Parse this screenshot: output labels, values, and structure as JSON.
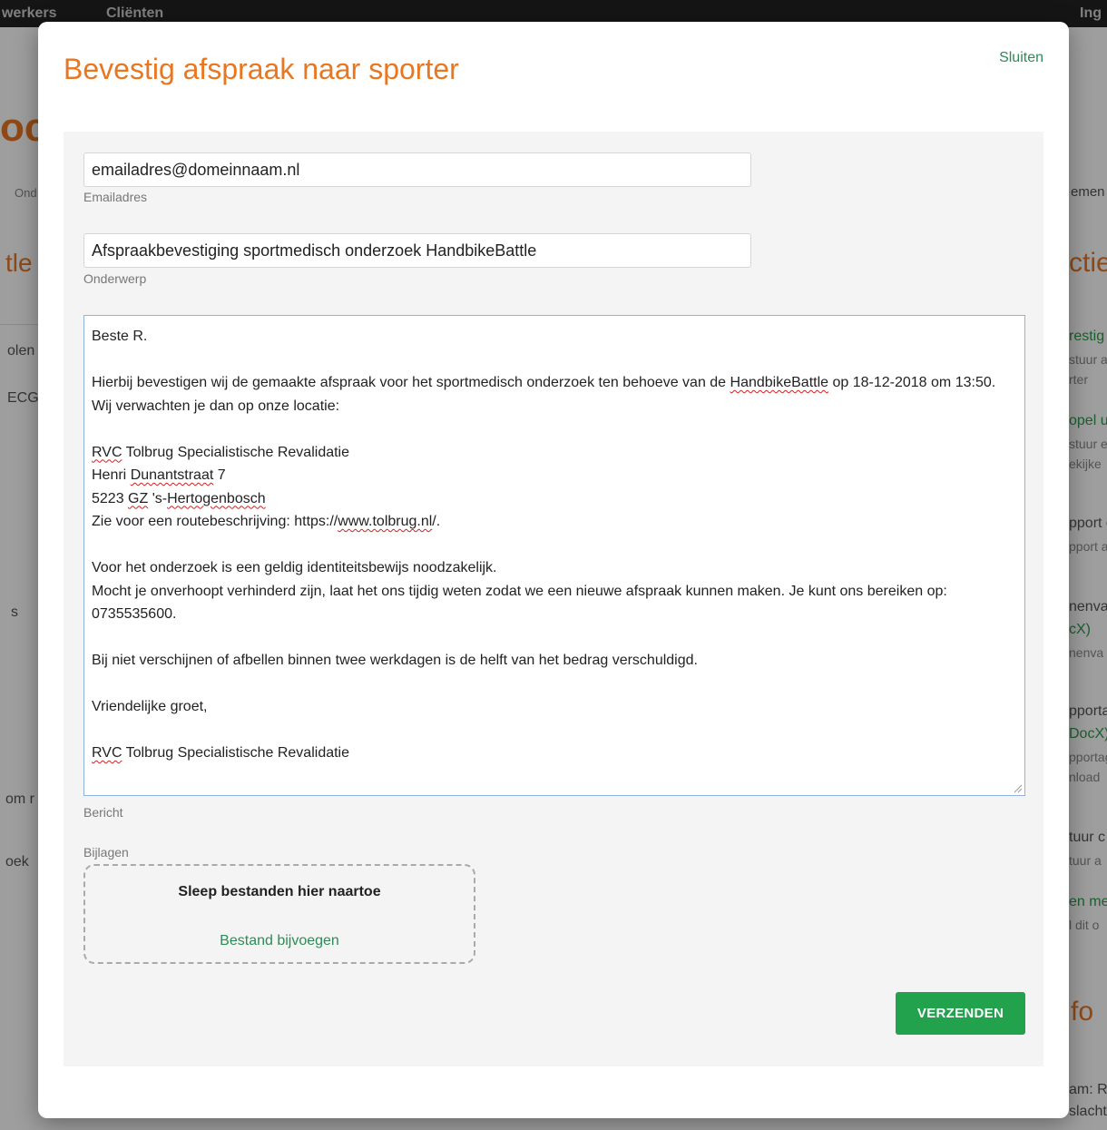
{
  "background": {
    "topbar": {
      "left_item": "werkers",
      "middle_item": "Cliënten",
      "right_item": "Ing"
    },
    "left_fragments": [
      "oc",
      "Ond",
      "tle",
      "olen",
      "ECG",
      "s",
      "om r",
      "oek"
    ],
    "right_fragments": [
      "emen",
      "ctie",
      "restig",
      "stuur a",
      "rter",
      "opel u",
      "stuur e",
      "ekijke",
      "pport o",
      "pport a",
      "nenva",
      "cX)",
      "nenva",
      "pporta",
      "DocX)",
      "pportag",
      "nload",
      "tuur c",
      "tuur a",
      "en me",
      "l dit o",
      "fo",
      "am: R",
      "slacht"
    ]
  },
  "modal": {
    "title": "Bevestig afspraak naar sporter",
    "close_label": "Sluiten",
    "email": {
      "value": "emailadres@domeinnaam.nl",
      "label": "Emailadres"
    },
    "subject": {
      "value": "Afspraakbevestiging sportmedisch onderzoek HandbikeBattle",
      "label": "Onderwerp"
    },
    "message": {
      "label": "Bericht",
      "greeting": "Beste R.",
      "para1_a": "Hierbij bevestigen wij de gemaakte afspraak voor het sportmedisch onderzoek ten behoeve van de ",
      "para1_brand": "HandbikeBattle",
      "para1_b": " op 18-12-2018 om 13:50. Wij verwachten je dan op onze locatie:",
      "address_org_abbr": "RVC",
      "address_org_rest": " Tolbrug Specialistische Revalidatie",
      "address_street_pre": "Henri ",
      "address_street_word": "Dunantstraat",
      "address_street_num": " 7",
      "address_zip_pre": "5223 ",
      "address_zip_code": "GZ",
      "address_city_pre": " 's-",
      "address_city": "Hertogenbosch",
      "route_pre": "Zie voor een routebeschrijving: https://",
      "route_link": "www.tolbrug.nl",
      "route_post": "/.",
      "id_line": "Voor het onderzoek is een geldig identiteitsbewijs noodzakelijk.",
      "cancel_line": "Mocht je onverhoopt verhinderd zijn, laat het ons tijdig weten zodat we een nieuwe afspraak kunnen maken. Je kunt ons bereiken op: 0735535600.",
      "fee_line": "Bij niet verschijnen of afbellen binnen twee werkdagen is de helft van het bedrag verschuldigd.",
      "closing": "Vriendelijke groet,",
      "signature_abbr": "RVC",
      "signature_rest": " Tolbrug Specialistische Revalidatie"
    },
    "attachments": {
      "label": "Bijlagen",
      "drop_text": "Sleep bestanden hier naartoe",
      "add_link": "Bestand bijvoegen"
    },
    "send_label": "VERZENDEN"
  },
  "colors": {
    "accent_orange": "#e87722",
    "accent_green": "#22a24c",
    "link_green": "#2e8b57"
  }
}
